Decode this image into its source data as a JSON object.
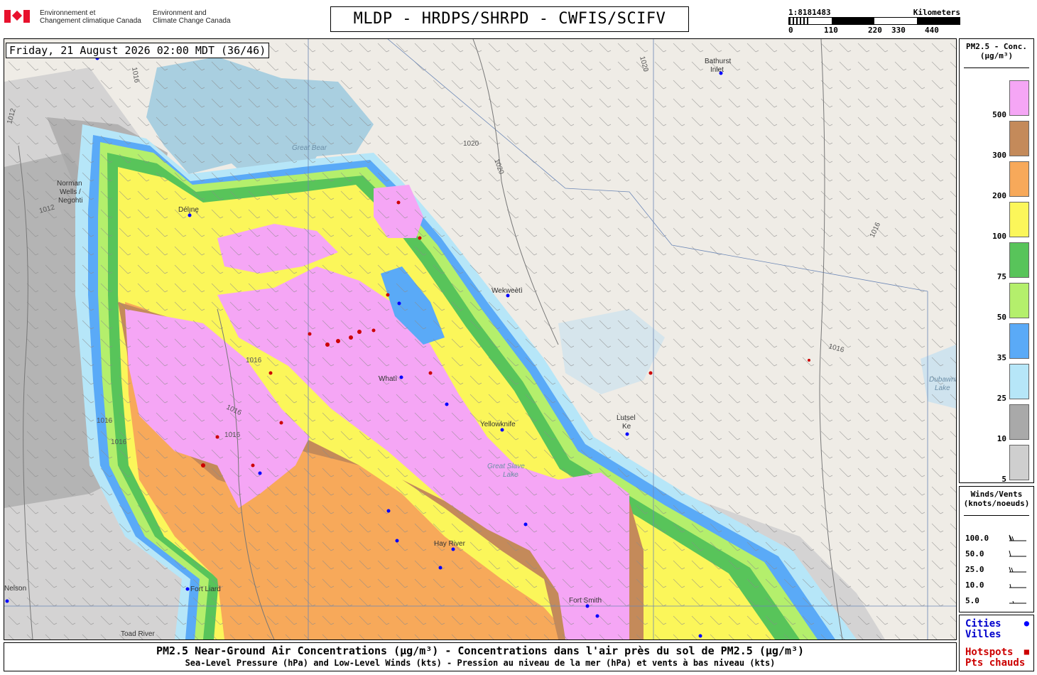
{
  "agency": {
    "name_fr": "Environnement et\nChangement climatique Canada",
    "name_en": "Environment and\nClimate Change Canada"
  },
  "title": "MLDP - HRDPS/SHRPD - CWFIS/SCIFV",
  "timestamp": "Friday, 21 August 2026 02:00 MDT (36/46)",
  "scale": {
    "ratio": "1:8181483",
    "unit": "Kilometers",
    "ticks": [
      "0",
      "110",
      "220",
      "330",
      "440"
    ]
  },
  "legend": {
    "title": "PM2.5 - Conc.\n(µg/m³)",
    "bins": [
      {
        "label": "500",
        "color": "#f5a6f5"
      },
      {
        "label": "300",
        "color": "#c48a5a"
      },
      {
        "label": "200",
        "color": "#f7a95a"
      },
      {
        "label": "100",
        "color": "#fbf65a"
      },
      {
        "label": "75",
        "color": "#58c45a"
      },
      {
        "label": "50",
        "color": "#b4ef6c"
      },
      {
        "label": "35",
        "color": "#5aaaf7"
      },
      {
        "label": "25",
        "color": "#b6e6f8"
      },
      {
        "label": "10",
        "color": "#a9a9a9"
      },
      {
        "label": "5",
        "color": "#cfcfcf"
      }
    ]
  },
  "wind_legend": {
    "title": "Winds/Vents\n(knots/noeuds)",
    "rows": [
      "100.0",
      "50.0",
      "25.0",
      "10.0",
      "5.0"
    ]
  },
  "location_legend": {
    "cities": "Cities",
    "villes": "Villes",
    "hotspots": "Hotspots",
    "pts_chauds": "Pts chauds",
    "city_color": "#0000ff",
    "hotspot_color": "#cc0000"
  },
  "places": [
    "Norman\nWells /\nNegohti",
    "Délı̨nę",
    "Bathurst\nInlet",
    "Wekweètì",
    "Whatì",
    "Yellowknife",
    "Lutsel\nKe",
    "Hay River",
    "Fort Liard",
    "Fort Smith",
    "Toad River",
    "Fort\nNelson",
    "Dubawnt\nLake",
    "Great Bear",
    "Great Slave\nLake"
  ],
  "isobars": [
    "1012",
    "1016",
    "1020",
    "1016",
    "1012",
    "1016",
    "1016",
    "1020",
    "1016",
    "1016",
    "1016",
    "1016",
    "1016"
  ],
  "caption": {
    "line1": "PM2.5 Near-Ground Air Concentrations (µg/m³) - Concentrations dans l'air près du sol de PM2.5 (µg/m³)",
    "line2": "Sea-Level Pressure (hPa) and Low-Level Winds (kts) - Pression au niveau de la mer (hPa) et vents à bas niveau (kts)"
  }
}
